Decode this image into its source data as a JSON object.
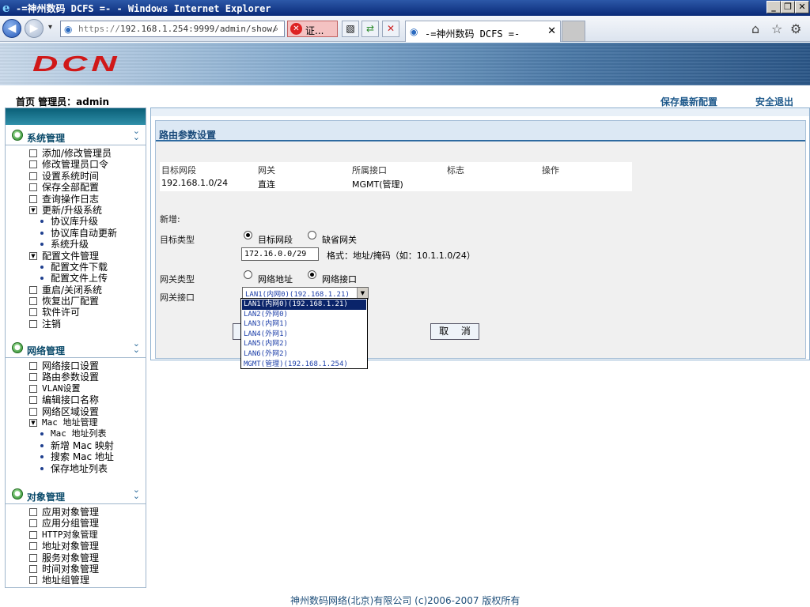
{
  "window": {
    "title": "-=神州数码 DCFS =- - Windows Internet Explorer",
    "minimize": "_",
    "restore": "❐",
    "close": "✕"
  },
  "browser": {
    "back": "◀",
    "forward": "▶",
    "dropdown": "▾",
    "url_scheme": "https://",
    "url_rest": "192.168.1.254:9999/admin/show/",
    "search_icon": "search-icon",
    "cert_label": "证...",
    "tab_title": "-=神州数码 DCFS =-",
    "tab_close": "✕",
    "icons": {
      "compat": "compatibility-icon",
      "refresh": "refresh-icon",
      "stop": "stop-icon",
      "home": "home-icon",
      "favorites": "star-icon",
      "tools": "gear-icon"
    }
  },
  "header": {
    "logo": "DCN",
    "breadcrumb": "首页 管理员：admin",
    "save_config": "保存最新配置",
    "logout": "安全退出"
  },
  "sidebar": {
    "sections": [
      {
        "title": "系统管理",
        "items": [
          {
            "label": "添加/修改管理员",
            "type": "box",
            "mark": ""
          },
          {
            "label": "修改管理员口令",
            "type": "box",
            "mark": ""
          },
          {
            "label": "设置系统时间",
            "type": "box",
            "mark": ""
          },
          {
            "label": "保存全部配置",
            "type": "box",
            "mark": ""
          },
          {
            "label": "查询操作日志",
            "type": "box",
            "mark": ""
          },
          {
            "label": "更新/升级系统",
            "type": "box",
            "mark": "▼"
          },
          {
            "label": "协议库升级",
            "type": "sub"
          },
          {
            "label": "协议库自动更新",
            "type": "sub"
          },
          {
            "label": "系统升级",
            "type": "sub"
          },
          {
            "label": "配置文件管理",
            "type": "box",
            "mark": "▼"
          },
          {
            "label": "配置文件下载",
            "type": "sub"
          },
          {
            "label": "配置文件上传",
            "type": "sub"
          },
          {
            "label": "重启/关闭系统",
            "type": "box",
            "mark": ""
          },
          {
            "label": "恢复出厂配置",
            "type": "box",
            "mark": ""
          },
          {
            "label": "软件许可",
            "type": "box",
            "mark": ""
          },
          {
            "label": "注销",
            "type": "box",
            "mark": ""
          }
        ]
      },
      {
        "title": "网络管理",
        "items": [
          {
            "label": "网络接口设置",
            "type": "box",
            "mark": ""
          },
          {
            "label": "路由参数设置",
            "type": "box",
            "mark": ""
          },
          {
            "label": "VLAN设置",
            "type": "box",
            "mark": ""
          },
          {
            "label": "编辑接口名称",
            "type": "box",
            "mark": ""
          },
          {
            "label": "网络区域设置",
            "type": "box",
            "mark": ""
          },
          {
            "label": "Mac 地址管理",
            "type": "box",
            "mark": "▼"
          },
          {
            "label": "Mac 地址列表",
            "type": "sub"
          },
          {
            "label": "新增 Mac 映射",
            "type": "sub"
          },
          {
            "label": "搜索 Mac 地址",
            "type": "sub"
          },
          {
            "label": "保存地址列表",
            "type": "sub"
          }
        ]
      },
      {
        "title": "对象管理",
        "items": [
          {
            "label": "应用对象管理",
            "type": "box",
            "mark": ""
          },
          {
            "label": "应用分组管理",
            "type": "box",
            "mark": ""
          },
          {
            "label": "HTTP对象管理",
            "type": "box",
            "mark": ""
          },
          {
            "label": "地址对象管理",
            "type": "box",
            "mark": ""
          },
          {
            "label": "服务对象管理",
            "type": "box",
            "mark": ""
          },
          {
            "label": "时间对象管理",
            "type": "box",
            "mark": ""
          },
          {
            "label": "地址组管理",
            "type": "box",
            "mark": ""
          }
        ]
      }
    ]
  },
  "panel": {
    "title": "路由参数设置",
    "table": {
      "headers": [
        "目标网段",
        "网关",
        "所属接口",
        "标志",
        "操作"
      ],
      "rows": [
        [
          "192.168.1.0/24",
          "直连",
          "MGMT(管理)",
          "",
          ""
        ]
      ]
    },
    "new_label": "新增:",
    "dest_type_label": "目标类型",
    "dest_type_options": [
      "目标网段",
      "缺省网关"
    ],
    "dest_value": "172.16.0.0/29",
    "dest_format": "格式：地址/掩码（如：10.1.1.0/24）",
    "gw_type_label": "网关类型",
    "gw_type_options": [
      "网络地址",
      "网络接口"
    ],
    "gw_iface_label": "网关接口",
    "gw_iface_selected": "LAN1(内网0)(192.168.1.21)",
    "gw_iface_options": [
      "LAN1(内网0)(192.168.1.21)",
      "LAN2(外网0)",
      "LAN3(内网1)",
      "LAN4(外网1)",
      "LAN5(内网2)",
      "LAN6(外网2)",
      "MGMT(管理)(192.168.1.254)"
    ],
    "cancel_label": "取 消"
  },
  "footer": {
    "copyright": "神州数码网络(北京)有限公司 (c)2006-2007 版权所有"
  }
}
